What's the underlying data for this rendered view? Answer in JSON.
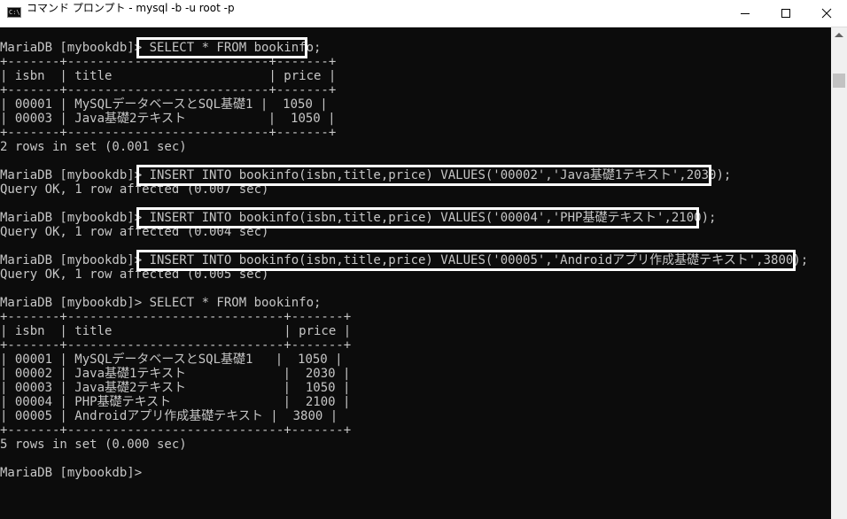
{
  "window": {
    "title": "コマンド プロンプト - mysql  -b -u root -p",
    "icon_label": "C:\\",
    "icons": {
      "app": "cmd-app-icon",
      "minimize": "minimize-icon",
      "maximize": "maximize-icon",
      "close": "close-icon"
    }
  },
  "colors": {
    "terminal_bg": "#0c0c0c",
    "terminal_fg": "#c6c6c6",
    "highlight_box": "#ffffff",
    "titlebar_bg": "#ffffff"
  },
  "terminal": {
    "lines": [
      "MariaDB [mybookdb]> SELECT * FROM bookinfo;",
      "+-------+---------------------------+-------+",
      "| isbn  | title                     | price |",
      "+-------+---------------------------+-------+",
      "| 00001 | MySQLデータベースとSQL基礎1 |  1050 |",
      "| 00003 | Java基礎2テキスト           |  1050 |",
      "+-------+---------------------------+-------+",
      "2 rows in set (0.001 sec)",
      "",
      "MariaDB [mybookdb]> INSERT INTO bookinfo(isbn,title,price) VALUES('00002','Java基礎1テキスト',2030);",
      "Query OK, 1 row affected (0.007 sec)",
      "",
      "MariaDB [mybookdb]> INSERT INTO bookinfo(isbn,title,price) VALUES('00004','PHP基礎テキスト',2100);",
      "Query OK, 1 row affected (0.004 sec)",
      "",
      "MariaDB [mybookdb]> INSERT INTO bookinfo(isbn,title,price) VALUES('00005','Androidアプリ作成基礎テキスト',3800);",
      "Query OK, 1 row affected (0.005 sec)",
      "",
      "MariaDB [mybookdb]> SELECT * FROM bookinfo;",
      "+-------+-----------------------------+-------+",
      "| isbn  | title                       | price |",
      "+-------+-----------------------------+-------+",
      "| 00001 | MySQLデータベースとSQL基礎1   |  1050 |",
      "| 00002 | Java基礎1テキスト             |  2030 |",
      "| 00003 | Java基礎2テキスト             |  1050 |",
      "| 00004 | PHP基礎テキスト               |  2100 |",
      "| 00005 | Androidアプリ作成基礎テキスト |  3800 |",
      "+-------+-----------------------------+-------+",
      "5 rows in set (0.000 sec)",
      "",
      "MariaDB [mybookdb]>"
    ]
  }
}
